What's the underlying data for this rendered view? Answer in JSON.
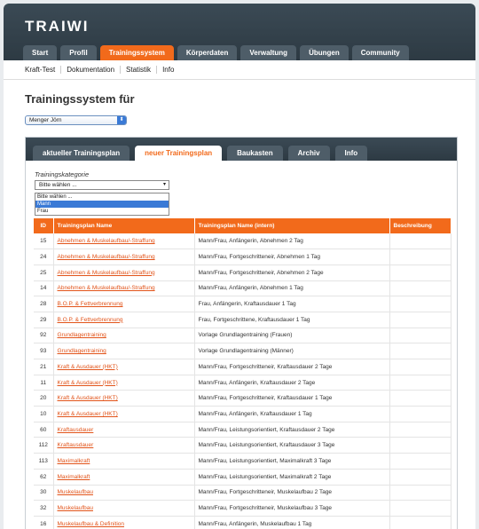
{
  "app": {
    "logo": "TRAIWI"
  },
  "main_tabs": [
    {
      "label": "Start"
    },
    {
      "label": "Profil"
    },
    {
      "label": "Trainingssystem",
      "active": true
    },
    {
      "label": "Körperdaten"
    },
    {
      "label": "Verwaltung"
    },
    {
      "label": "Übungen"
    },
    {
      "label": "Community"
    }
  ],
  "sub_nav": [
    "Kraft-Test",
    "Dokumentation",
    "Statistik",
    "Info"
  ],
  "page": {
    "title": "Trainingssystem für"
  },
  "user_select": {
    "value": "Menger Jörn"
  },
  "panel_tabs": [
    {
      "label": "aktueller Trainingsplan"
    },
    {
      "label": "neuer Trainingsplan",
      "active": true
    },
    {
      "label": "Baukasten"
    },
    {
      "label": "Archiv"
    },
    {
      "label": "Info"
    }
  ],
  "category": {
    "label": "Trainingskategorie",
    "value": "Bitte wählen ...",
    "options": [
      "Bitte wählen ...",
      "Mann",
      "Frau"
    ],
    "highlighted": "Mann"
  },
  "table": {
    "headers": [
      "ID",
      "Trainingsplan Name",
      "Trainingsplan Name (intern)",
      "Beschreibung"
    ],
    "rows": [
      [
        "15",
        "Abnehmen & Muskelaufbau/-Straffung",
        "Mann/Frau, Anfängerin, Abnehmen 2 Tag",
        ""
      ],
      [
        "24",
        "Abnehmen & Muskelaufbau/-Straffung",
        "Mann/Frau, Fortgeschritteneir, Abnehmen 1 Tag",
        ""
      ],
      [
        "25",
        "Abnehmen & Muskelaufbau/-Straffung",
        "Mann/Frau, Fortgeschritteneir, Abnehmen 2 Tage",
        ""
      ],
      [
        "14",
        "Abnehmen & Muskelaufbau/-Straffung",
        "Mann/Frau, Anfängerin, Abnehmen 1 Tag",
        ""
      ],
      [
        "28",
        "B.O.P. & Fettverbrennung",
        "Frau, Anfängerin, Kraftausdauer 1 Tag",
        ""
      ],
      [
        "29",
        "B.O.P. & Fettverbrennung",
        "Frau, Fortgeschrittene, Kraftausdauer 1 Tag",
        ""
      ],
      [
        "92",
        "Grundlagentraining",
        "Vorlage Grundlagentraining (Frauen)",
        ""
      ],
      [
        "93",
        "Grundlagentraining",
        "Vorlage Grundlagentraining (Männer)",
        ""
      ],
      [
        "21",
        "Kraft & Ausdauer (HKT)",
        "Mann/Frau, Fortgeschritteneir, Kraftausdauer 2 Tage",
        ""
      ],
      [
        "11",
        "Kraft & Ausdauer (HKT)",
        "Mann/Frau, Anfängerin, Kraftausdauer 2 Tage",
        ""
      ],
      [
        "20",
        "Kraft & Ausdauer (HKT)",
        "Mann/Frau, Fortgeschritteneir, Kraftausdauer 1 Tage",
        ""
      ],
      [
        "10",
        "Kraft & Ausdauer (HKT)",
        "Mann/Frau, Anfängerin, Kraftausdauer 1 Tag",
        ""
      ],
      [
        "60",
        "Kraftausdauer",
        "Mann/Frau, Leistungsorientiert, Kraftausdauer 2 Tage",
        ""
      ],
      [
        "112",
        "Kraftausdauer",
        "Mann/Frau, Leistungsorientiert, Kraftausdauer 3 Tage",
        ""
      ],
      [
        "113",
        "Maximalkraft",
        "Mann/Frau, Leistungsorientiert, Maximalkraft 3 Tage",
        ""
      ],
      [
        "62",
        "Maximalkraft",
        "Mann/Frau, Leistungsorientiert, Maximalkraft 2 Tage",
        ""
      ],
      [
        "30",
        "Muskelaufbau",
        "Mann/Frau, Fortgeschritteneir, Muskelaufbau 2 Tage",
        ""
      ],
      [
        "32",
        "Muskelaufbau",
        "Mann/Frau, Fortgeschritteneir, Muskelaufbau 3 Tage",
        ""
      ],
      [
        "16",
        "Muskelaufbau & Definition",
        "Mann/Frau, Anfängerin, Muskelaufbau 1 Tag",
        ""
      ]
    ]
  },
  "colors": {
    "accent": "#f26a1b",
    "header_dark": "#2d3a43",
    "link": "#e2541a",
    "selection": "#3a7ad6"
  }
}
